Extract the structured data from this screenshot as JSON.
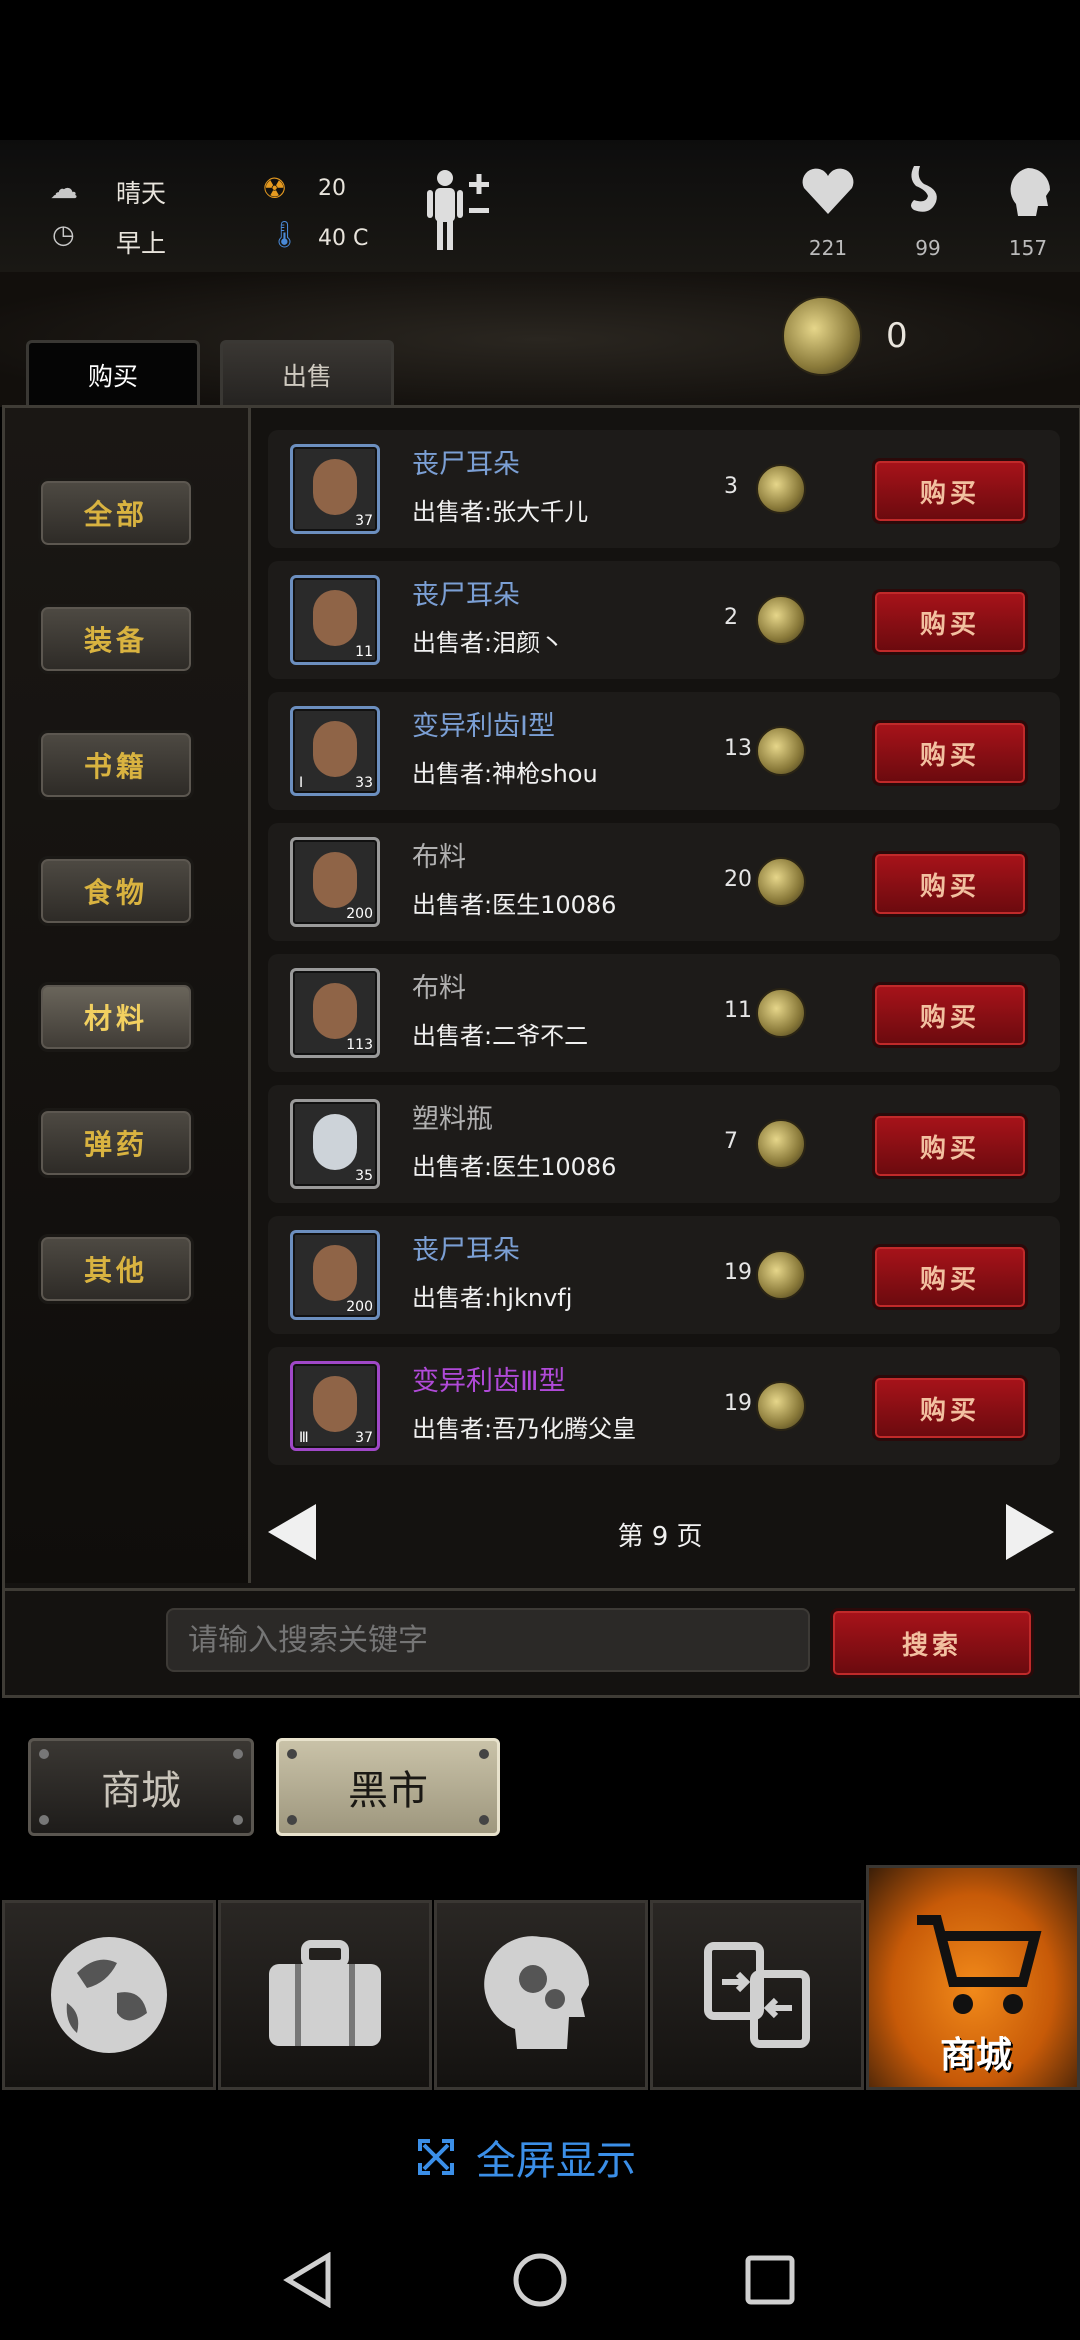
{
  "status": {
    "weather": "晴天",
    "time_of_day": "早上",
    "radiation": "20",
    "temperature": "40 C",
    "health": "221",
    "hunger": "99",
    "mood": "157"
  },
  "shop_top": {
    "tabs": [
      {
        "label": "购买",
        "active": true
      },
      {
        "label": "出售",
        "active": false
      }
    ],
    "coins": "0"
  },
  "categories": [
    {
      "label": "全部",
      "selected": false
    },
    {
      "label": "装备",
      "selected": false
    },
    {
      "label": "书籍",
      "selected": false
    },
    {
      "label": "食物",
      "selected": false
    },
    {
      "label": "材料",
      "selected": true
    },
    {
      "label": "弹药",
      "selected": false
    },
    {
      "label": "其他",
      "selected": false
    }
  ],
  "listings": [
    {
      "name": "丧尸耳朵",
      "seller": "出售者:张大千儿",
      "price": "3",
      "qty": "37",
      "tier": "",
      "color": "#7b9fd4",
      "icon": "ear-icon",
      "button": "购买"
    },
    {
      "name": "丧尸耳朵",
      "seller": "出售者:泪颜丶",
      "price": "2",
      "qty": "11",
      "tier": "",
      "color": "#7b9fd4",
      "icon": "ear-icon",
      "button": "购买"
    },
    {
      "name": "变异利齿Ⅰ型",
      "seller": "出售者:神枪shou",
      "price": "13",
      "qty": "33",
      "tier": "Ⅰ",
      "color": "#7b9fd4",
      "icon": "fang-icon",
      "button": "购买"
    },
    {
      "name": "布料",
      "seller": "出售者:医生10086",
      "price": "20",
      "qty": "200",
      "tier": "",
      "color": "#b0b0b0",
      "icon": "cloth-icon",
      "button": "购买"
    },
    {
      "name": "布料",
      "seller": "出售者:二爷不二",
      "price": "11",
      "qty": "113",
      "tier": "",
      "color": "#b0b0b0",
      "icon": "cloth-icon",
      "button": "购买"
    },
    {
      "name": "塑料瓶",
      "seller": "出售者:医生10086",
      "price": "7",
      "qty": "35",
      "tier": "",
      "color": "#b0b0b0",
      "icon": "bottle-icon",
      "button": "购买"
    },
    {
      "name": "丧尸耳朵",
      "seller": "出售者:hjknvfj",
      "price": "19",
      "qty": "200",
      "tier": "",
      "color": "#7b9fd4",
      "icon": "ear-icon",
      "button": "购买"
    },
    {
      "name": "变异利齿Ⅲ型",
      "seller": "出售者:吾乃化腾父皇",
      "price": "19",
      "qty": "37",
      "tier": "Ⅲ",
      "color": "#b04ad8",
      "icon": "fang-icon",
      "button": "购买"
    }
  ],
  "pagination": {
    "label": "第 9 页"
  },
  "search": {
    "placeholder": "请输入搜索关键字",
    "button": "搜索"
  },
  "shop_switch": {
    "mall": "商城",
    "black_market": "黑市"
  },
  "bottom_nav": {
    "active_label": "商城"
  },
  "fullscreen": {
    "label": "全屏显示"
  }
}
